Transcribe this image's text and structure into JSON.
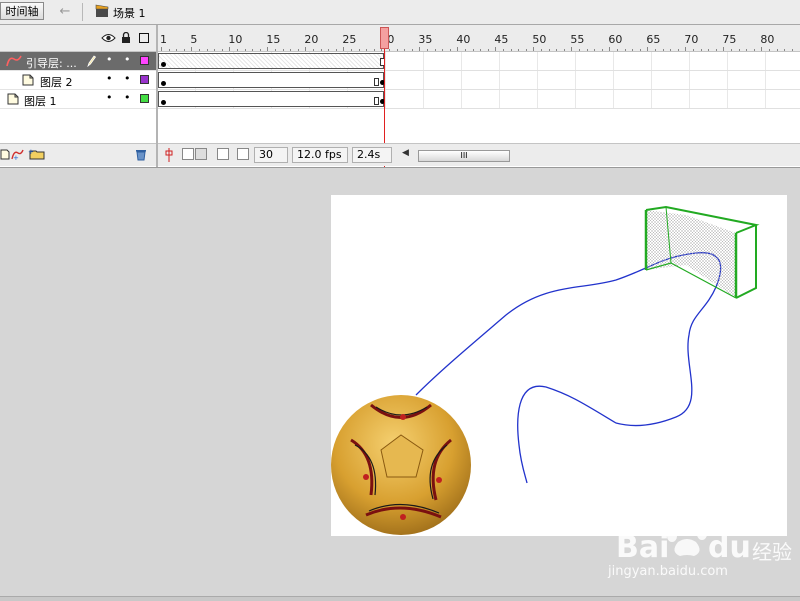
{
  "toolbar": {
    "timeline_tab": "时间轴",
    "back_icon": "back-arrow-icon",
    "scene_label": "场景 1"
  },
  "layers": [
    {
      "name": "引导层: ...",
      "selected": true,
      "color": "#ff44ff",
      "type": "guide"
    },
    {
      "name": "图层 2",
      "selected": false,
      "color": "#9933cc",
      "type": "normal"
    },
    {
      "name": "图层 1",
      "selected": false,
      "color": "#44dd44",
      "type": "normal"
    }
  ],
  "ruler": {
    "labels": [
      "1",
      "5",
      "10",
      "15",
      "20",
      "25",
      "30",
      "35",
      "40",
      "45",
      "50",
      "55",
      "60",
      "65",
      "70",
      "75",
      "80"
    ]
  },
  "footer": {
    "current_frame": "30",
    "fps": "12.0 fps",
    "time": "2.4s",
    "scroll_grip": "III"
  },
  "colors": {
    "path": "#2233cc",
    "goal_net": "#22aa22",
    "ball": "#d8a030",
    "playhead": "#e02020"
  },
  "watermark": {
    "brand": "Bai",
    "brand2": "du",
    "suffix": "经验",
    "url": "jingyan.baidu.com"
  }
}
